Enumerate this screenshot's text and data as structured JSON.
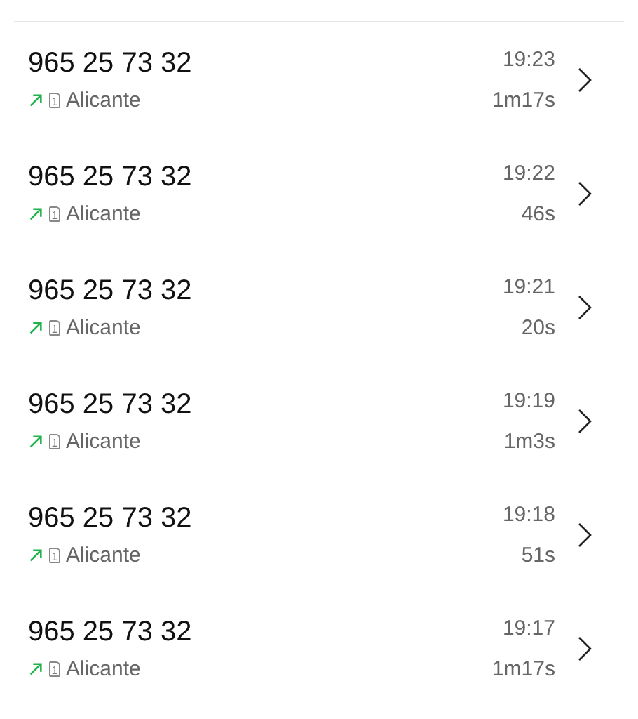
{
  "calls": [
    {
      "number": "965 25 73 32",
      "kind": "outgoing",
      "sim": "1",
      "location": "Alicante",
      "time": "19:23",
      "duration": "1m17s"
    },
    {
      "number": "965 25 73 32",
      "kind": "outgoing",
      "sim": "1",
      "location": "Alicante",
      "time": "19:22",
      "duration": "46s"
    },
    {
      "number": "965 25 73 32",
      "kind": "outgoing",
      "sim": "1",
      "location": "Alicante",
      "time": "19:21",
      "duration": "20s"
    },
    {
      "number": "965 25 73 32",
      "kind": "outgoing",
      "sim": "1",
      "location": "Alicante",
      "time": "19:19",
      "duration": "1m3s"
    },
    {
      "number": "965 25 73 32",
      "kind": "outgoing",
      "sim": "1",
      "location": "Alicante",
      "time": "19:18",
      "duration": "51s"
    },
    {
      "number": "965 25 73 32",
      "kind": "outgoing",
      "sim": "1",
      "location": "Alicante",
      "time": "19:17",
      "duration": "1m17s"
    }
  ]
}
